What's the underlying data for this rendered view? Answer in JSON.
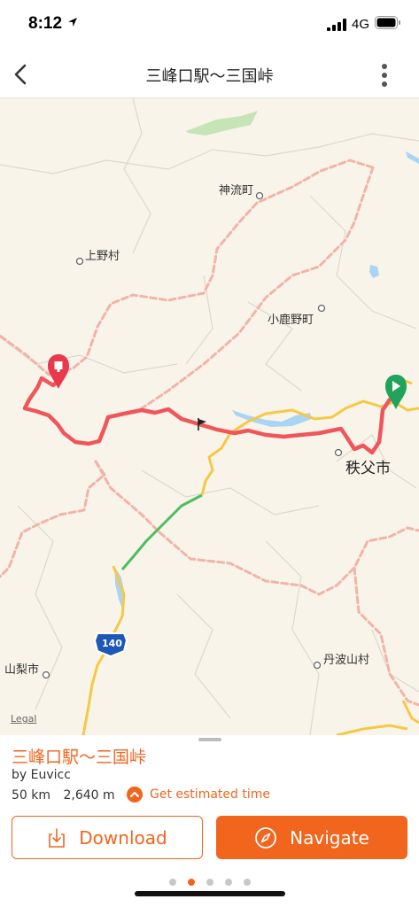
{
  "status_bar": {
    "time": "8:12",
    "network": "4G",
    "location_icon": "location-arrow-icon",
    "signal_icon": "signal-bars-icon",
    "battery_icon": "battery-icon"
  },
  "header": {
    "title": "三峰口駅〜三国峠",
    "back_icon": "chevron-left-icon",
    "more_icon": "vertical-ellipsis-icon"
  },
  "map": {
    "labels": {
      "kanna": "神流町",
      "ueno": "上野村",
      "ogano": "小鹿野町",
      "chichibu": "秩父市",
      "yamanashi": "山梨市",
      "tabayama": "丹波山村",
      "route_shield": "140"
    },
    "legal": "Legal",
    "start_marker_icon": "play-pin-icon",
    "end_marker_icon": "stop-pin-icon",
    "flag_icon": "flag-icon",
    "colors": {
      "route": "#f0555a",
      "major_road": "#f6c845",
      "toll_road": "#4cbf5f",
      "water": "#a9d5f3",
      "park": "#c7e4b6",
      "border": "#f2b4a8",
      "start_pin": "#21a35b",
      "end_pin": "#e9394a"
    }
  },
  "sheet": {
    "title": "三峰口駅〜三国峠",
    "author": "by Euvicc",
    "distance": "50 km",
    "elevation": "2,640 m",
    "estimate_label": "Get estimated time",
    "estimate_icon": "chevron-up-circle-icon",
    "download_label": "Download",
    "download_icon": "download-icon",
    "navigate_label": "Navigate",
    "navigate_icon": "compass-icon",
    "page_count": 5,
    "active_page": 2,
    "accent_color": "#f2651d"
  }
}
